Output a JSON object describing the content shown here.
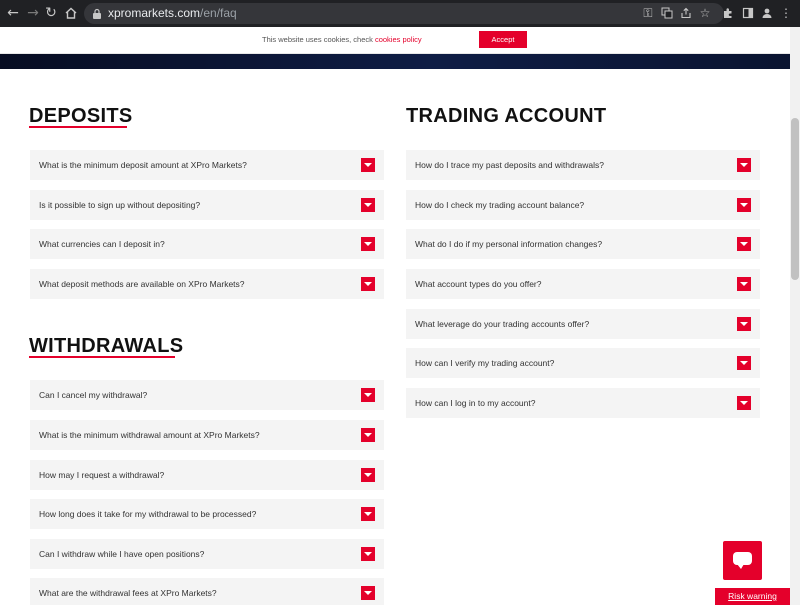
{
  "browser": {
    "url_domain": "xpromarkets.com",
    "url_path": "/en/faq"
  },
  "cookie_bar": {
    "text": "This website uses cookies, check ",
    "link": "cookies policy",
    "accept_label": "Accept"
  },
  "deposits": {
    "title": "DEPOSITS",
    "items": [
      "What is the minimum deposit amount at XPro Markets?",
      "Is it possible to sign up without depositing?",
      "What currencies can I deposit in?",
      "What deposit methods are available on XPro Markets?"
    ]
  },
  "withdrawals": {
    "title": "WITHDRAWALS",
    "items": [
      "Can I cancel my withdrawal?",
      "What is the minimum withdrawal amount at XPro Markets?",
      "How may I request a withdrawal?",
      "How long does it take for my withdrawal to be processed?",
      "Can I withdraw while I have open positions?",
      "What are the withdrawal fees at XPro Markets?"
    ]
  },
  "trading_account": {
    "title": "TRADING ACCOUNT",
    "items": [
      "How do I trace my past deposits and withdrawals?",
      "How do I check my trading account balance?",
      "What do I do if my personal information changes?",
      "What account types do you offer?",
      "What leverage do your trading accounts offer?",
      "How can I verify my trading account?",
      "How can I log in to my account?"
    ]
  },
  "risk_warning": "Risk warning",
  "colors": {
    "accent": "#e4002b",
    "faq_bg": "#f4f4f4",
    "chrome_bg": "#202124"
  }
}
